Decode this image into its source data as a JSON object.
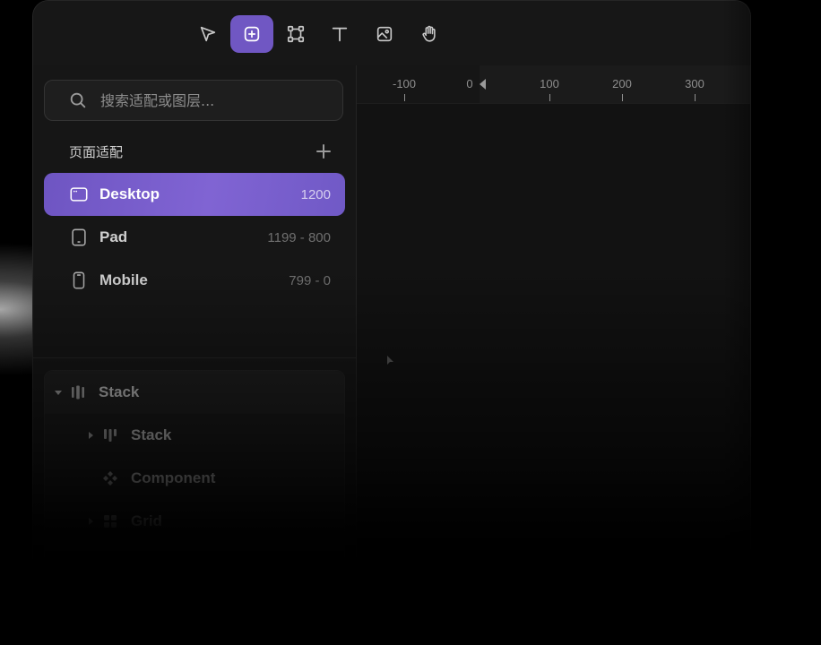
{
  "toolbar": {
    "tools": [
      {
        "name": "select",
        "icon": "cursor-arrow-icon"
      },
      {
        "name": "frame",
        "icon": "plus-square-icon",
        "active": true
      },
      {
        "name": "shape",
        "icon": "bounding-box-icon"
      },
      {
        "name": "text",
        "icon": "text-t-icon"
      },
      {
        "name": "image",
        "icon": "image-icon"
      },
      {
        "name": "hand",
        "icon": "hand-icon"
      }
    ],
    "accent_color": "#7057c3"
  },
  "sidebar": {
    "search": {
      "placeholder": "搜索适配或图层..."
    },
    "section_title": "页面适配",
    "breakpoints": [
      {
        "label": "Desktop",
        "range": "1200",
        "icon": "desktop-icon",
        "active": true
      },
      {
        "label": "Pad",
        "range": "1199 - 800",
        "icon": "tablet-icon"
      },
      {
        "label": "Mobile",
        "range": "799 - 0",
        "icon": "mobile-icon"
      }
    ],
    "layers": [
      {
        "label": "Stack",
        "icon": "stack-icon",
        "expanded": true
      },
      {
        "label": "Stack",
        "icon": "stack-icon"
      },
      {
        "label": "Component",
        "icon": "component-icon"
      },
      {
        "label": "Grid",
        "icon": "grid-icon"
      }
    ]
  },
  "canvas": {
    "ruler_labels": [
      "-100",
      "0",
      "100",
      "200",
      "300"
    ]
  }
}
